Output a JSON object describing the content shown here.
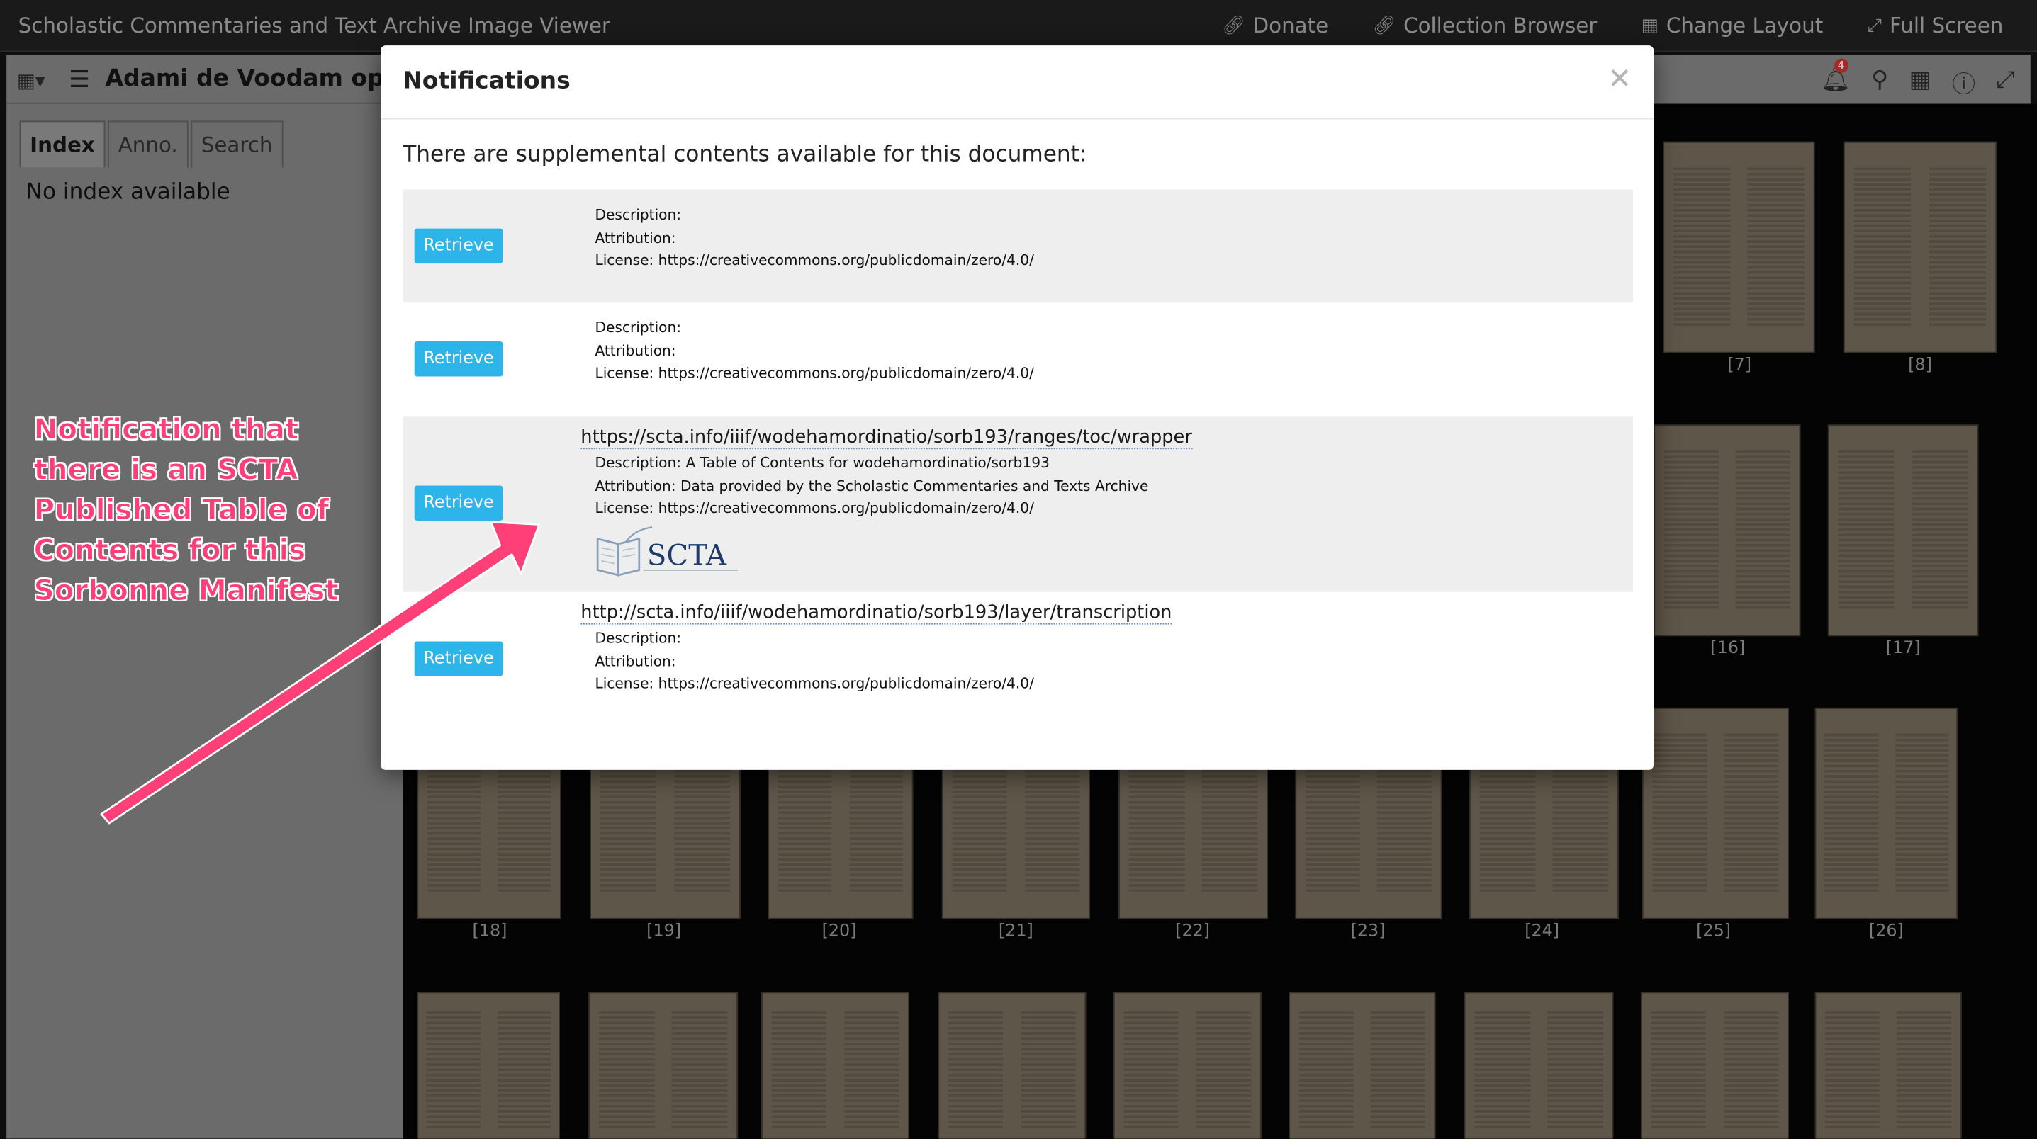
{
  "app": {
    "title": "Scholastic Commentaries and Text Archive Image Viewer",
    "nav": [
      {
        "label": "Donate",
        "icon": "link-icon"
      },
      {
        "label": "Collection Browser",
        "icon": "link-icon"
      },
      {
        "label": "Change Layout",
        "icon": "layout-grid-icon"
      },
      {
        "label": "Full Screen",
        "icon": "expand-icon"
      }
    ]
  },
  "left_panel": {
    "title": "Adami de Voodam opus",
    "tabs": [
      "Index",
      "Anno.",
      "Search"
    ],
    "active_tab": "Index",
    "empty_message": "No index available"
  },
  "window_toolbar": {
    "notification_count": "4",
    "icons": [
      "bell-icon",
      "search-lock-icon",
      "grid-icon",
      "info-icon",
      "expand-icon"
    ]
  },
  "thumbnails": {
    "labels": [
      "[7]",
      "[8]",
      "[16]",
      "[17]",
      "[18]",
      "[19]",
      "[20]",
      "[21]",
      "[22]",
      "[23]",
      "[24]",
      "[25]",
      "[26]"
    ]
  },
  "modal": {
    "title": "Notifications",
    "intro": "There are supplemental contents available for this document:",
    "retrieve_label": "Retrieve",
    "items": [
      {
        "url": "",
        "description": "Description:",
        "attribution": "Attribution:",
        "license": "License: https://creativecommons.org/publicdomain/zero/4.0/"
      },
      {
        "url": "",
        "description": "Description:",
        "attribution": "Attribution:",
        "license": "License: https://creativecommons.org/publicdomain/zero/4.0/"
      },
      {
        "url": "https://scta.info/iiif/wodehamordinatio/sorb193/ranges/toc/wrapper",
        "description": "Description: A Table of Contents for wodehamordinatio/sorb193",
        "attribution": "Attribution: Data provided by the Scholastic Commentaries and Texts Archive",
        "license": "License: https://creativecommons.org/publicdomain/zero/4.0/",
        "logo": "SCTA"
      },
      {
        "url": "http://scta.info/iiif/wodehamordinatio/sorb193/layer/transcription",
        "description": "Description:",
        "attribution": "Attribution:",
        "license": "License: https://creativecommons.org/publicdomain/zero/4.0/"
      }
    ]
  },
  "annotation": {
    "lines": [
      "Notification that",
      "there is an SCTA",
      "Published Table of",
      "Contents for this",
      "Sorbonne Manifest"
    ],
    "color": "#ff3f77"
  }
}
